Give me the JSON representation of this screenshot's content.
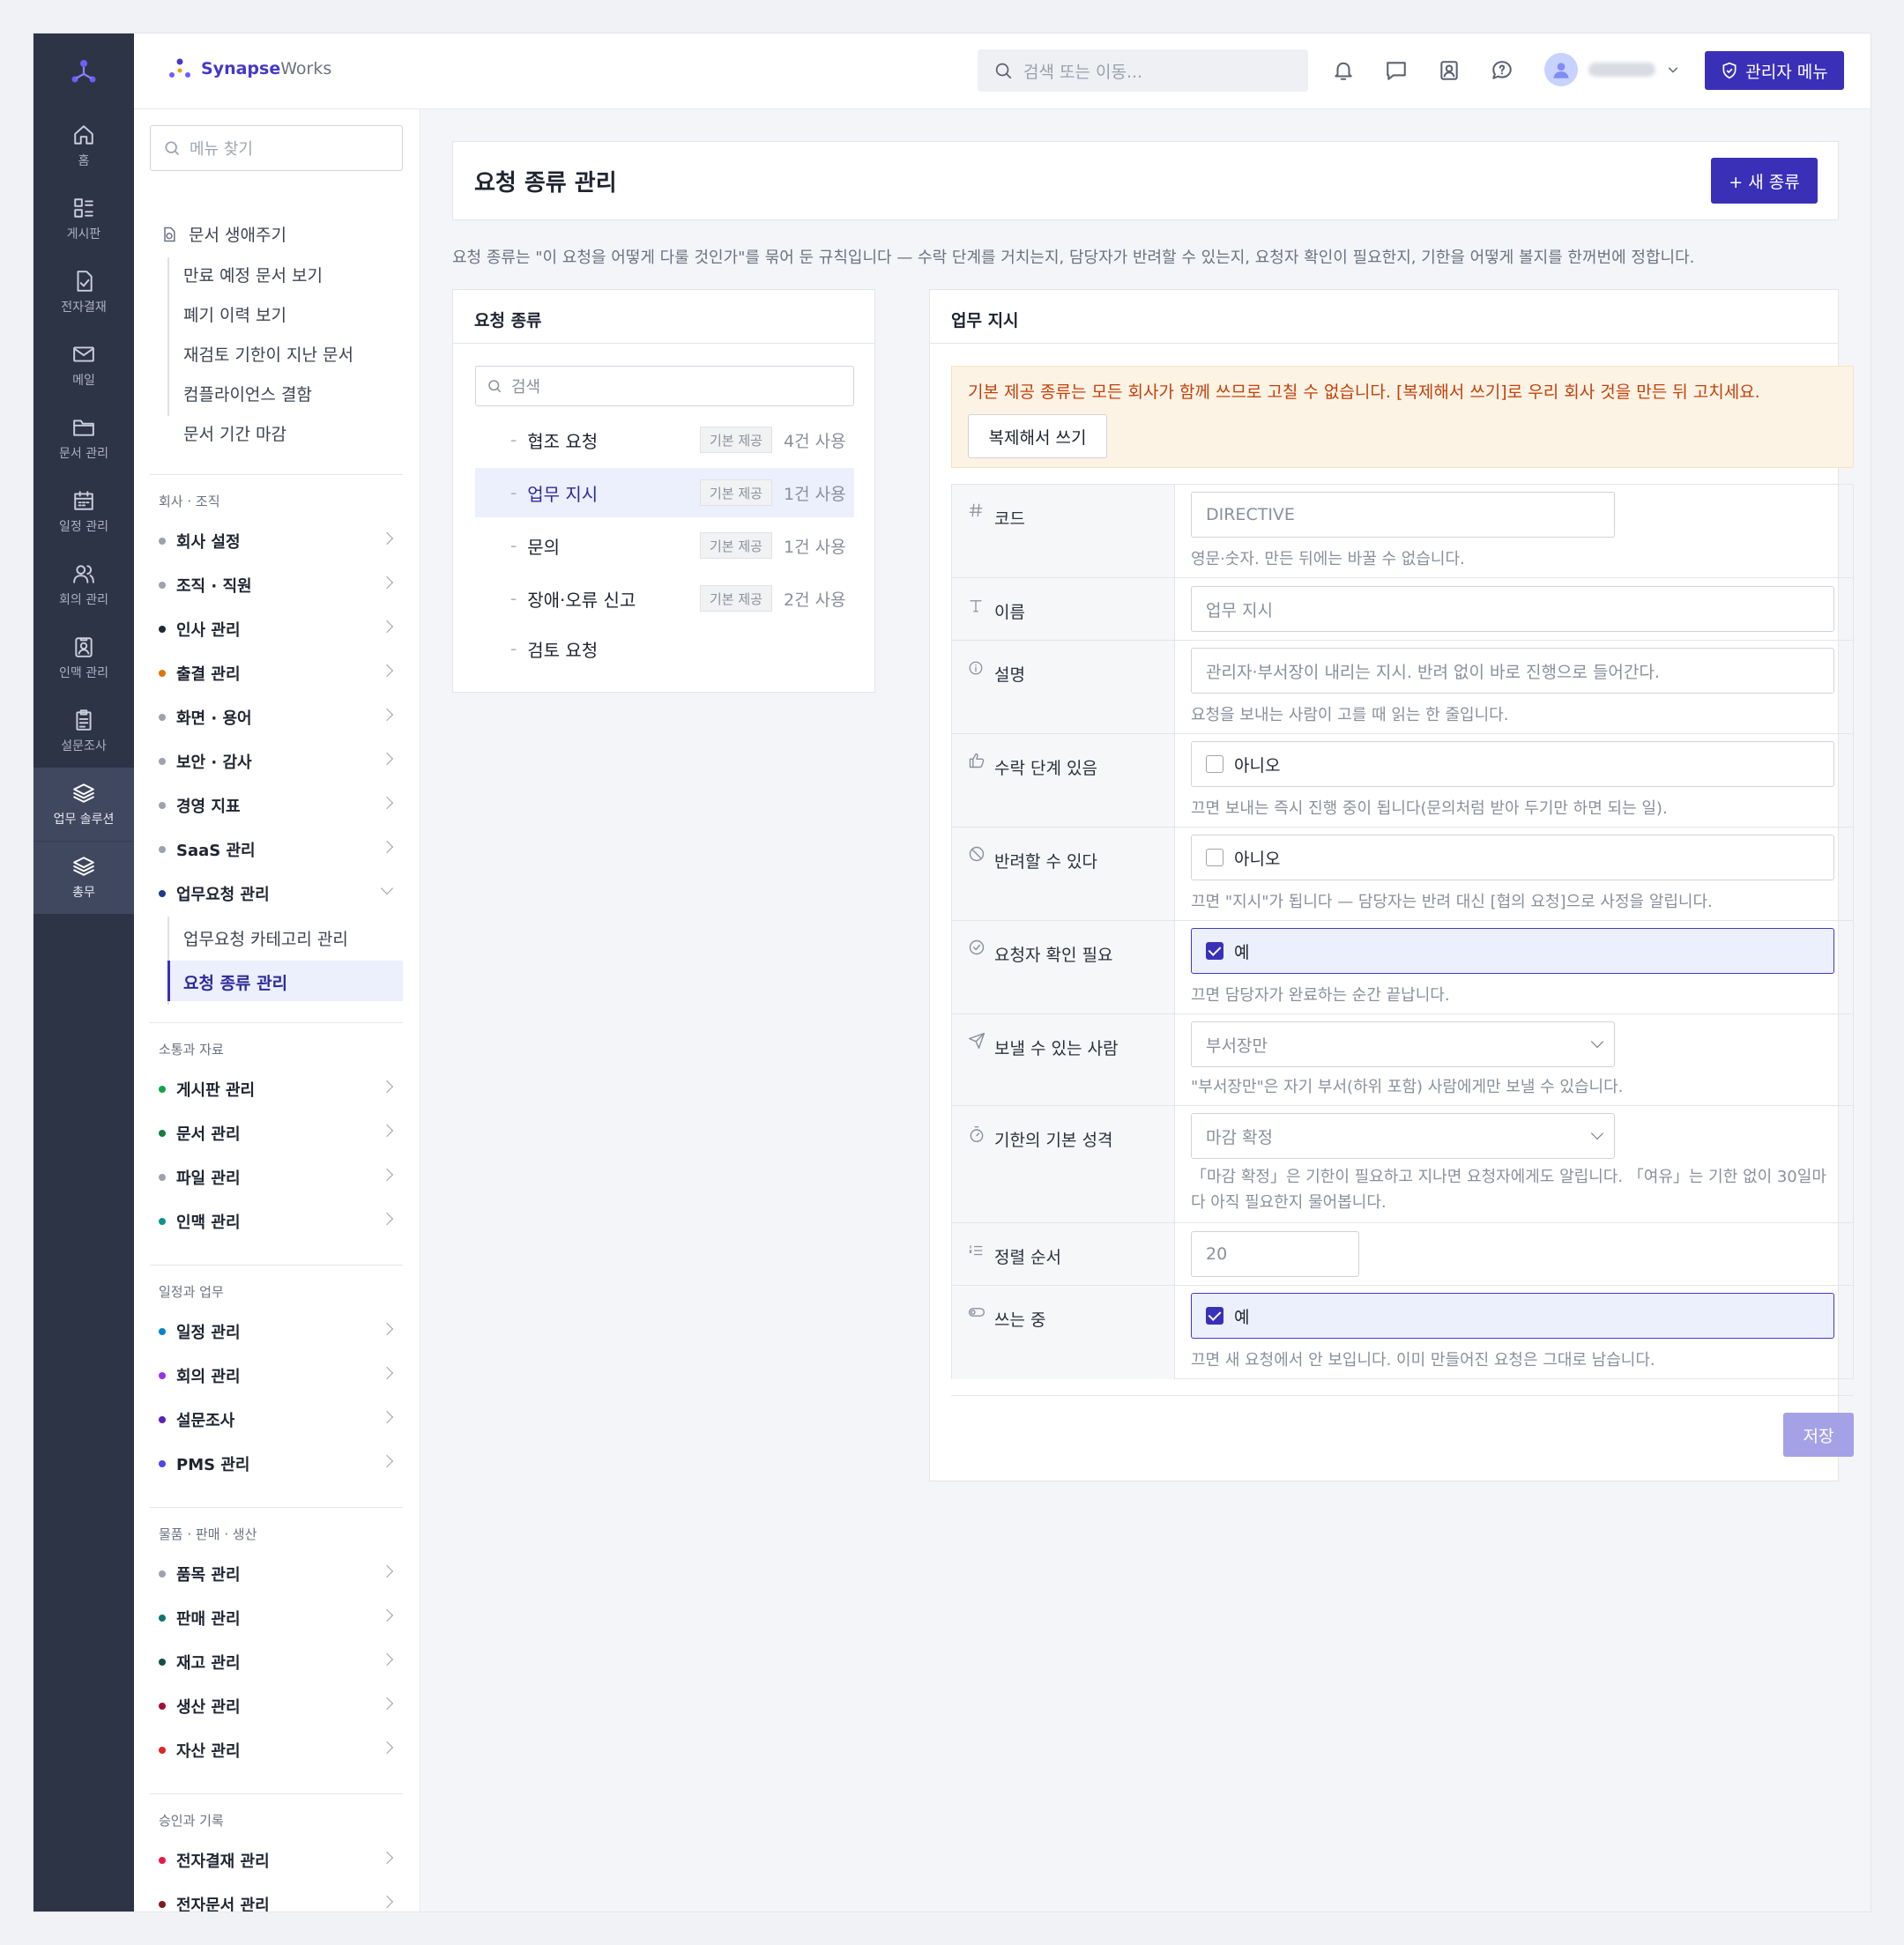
{
  "topbar": {
    "brand_primary": "Synapse",
    "brand_secondary": "Works",
    "search_placeholder": "검색 또는 이동...",
    "admin_button": "관리자 메뉴"
  },
  "rail": [
    {
      "label": "홈",
      "icon": "home-icon"
    },
    {
      "label": "게시판",
      "icon": "board-icon"
    },
    {
      "label": "전자결재",
      "icon": "approval-icon"
    },
    {
      "label": "메일",
      "icon": "mail-icon"
    },
    {
      "label": "문서 관리",
      "icon": "folder-icon"
    },
    {
      "label": "일정 관리",
      "icon": "calendar-icon"
    },
    {
      "label": "회의 관리",
      "icon": "people-icon"
    },
    {
      "label": "인맥 관리",
      "icon": "contact-icon"
    },
    {
      "label": "설문조사",
      "icon": "clipboard-icon"
    },
    {
      "label": "업무 솔루션",
      "icon": "layers-icon",
      "active": true
    },
    {
      "label": "총무",
      "icon": "layers-icon",
      "active": true
    }
  ],
  "sidenav": {
    "search_placeholder": "메뉴 찾기",
    "lifecycle": {
      "title": "문서 생애주기",
      "items": [
        "만료 예정 문서 보기",
        "폐기 이력 보기",
        "재검토 기한이 지난 문서",
        "컴플라이언스 결함",
        "문서 기간 마감"
      ]
    },
    "sections": [
      {
        "title": "회사 · 조직",
        "items": [
          {
            "label": "회사 설정",
            "color": "#9ca3af"
          },
          {
            "label": "조직 · 직원",
            "color": "#9ca3af"
          },
          {
            "label": "인사 관리",
            "color": "#1f2937"
          },
          {
            "label": "출결 관리",
            "color": "#d97706"
          },
          {
            "label": "화면 · 용어",
            "color": "#9ca3af"
          },
          {
            "label": "보안 · 감사",
            "color": "#9ca3af"
          },
          {
            "label": "경영 지표",
            "color": "#9ca3af"
          },
          {
            "label": "SaaS 관리",
            "color": "#9ca3af"
          },
          {
            "label": "업무요청 관리",
            "color": "#1e3a8a"
          }
        ]
      },
      {
        "title": "소통과 자료",
        "items": [
          {
            "label": "게시판 관리",
            "color": "#16a34a"
          },
          {
            "label": "문서 관리",
            "color": "#15803d"
          },
          {
            "label": "파일 관리",
            "color": "#9ca3af"
          },
          {
            "label": "인맥 관리",
            "color": "#0d9488"
          }
        ]
      },
      {
        "title": "일정과 업무",
        "items": [
          {
            "label": "일정 관리",
            "color": "#0284c7"
          },
          {
            "label": "회의 관리",
            "color": "#9333ea"
          },
          {
            "label": "설문조사",
            "color": "#5b21b6"
          },
          {
            "label": "PMS 관리",
            "color": "#4f46e5"
          }
        ]
      },
      {
        "title": "물품 · 판매 · 생산",
        "items": [
          {
            "label": "품목 관리",
            "color": "#9ca3af"
          },
          {
            "label": "판매 관리",
            "color": "#0f766e"
          },
          {
            "label": "재고 관리",
            "color": "#134e4a"
          },
          {
            "label": "생산 관리",
            "color": "#9f1239"
          },
          {
            "label": "자산 관리",
            "color": "#dc2626"
          }
        ]
      },
      {
        "title": "승인과 기록",
        "items": [
          {
            "label": "전자결재 관리",
            "color": "#e11d48"
          },
          {
            "label": "전자문서 관리",
            "color": "#7f1d1d"
          }
        ]
      }
    ],
    "work_request_sub": [
      "업무요청 카테고리 관리",
      "요청 종류 관리"
    ]
  },
  "page": {
    "title": "요청 종류 관리",
    "new_button": "+ 새 종류",
    "description": "요청 종류는 \"이 요청을 어떻게 다룰 것인가\"를 묶어 둔 규칙입니다 — 수락 단계를 거치는지, 담당자가 반려할 수 있는지, 요청자 확인이 필요한지, 기한을 어떻게 볼지를 한꺼번에 정합니다."
  },
  "types_panel": {
    "title": "요청 종류",
    "search_placeholder": "검색",
    "items": [
      {
        "name": "협조 요청",
        "tag": "기본 제공",
        "usage": "4건 사용"
      },
      {
        "name": "업무 지시",
        "tag": "기본 제공",
        "usage": "1건 사용",
        "active": true
      },
      {
        "name": "문의",
        "tag": "기본 제공",
        "usage": "1건 사용"
      },
      {
        "name": "장애·오류 신고",
        "tag": "기본 제공",
        "usage": "2건 사용"
      },
      {
        "name": "검토 요청",
        "tag": "",
        "usage": ""
      }
    ]
  },
  "detail": {
    "title": "업무 지시",
    "notice": "기본 제공 종류는 모든 회사가 함께 쓰므로 고칠 수 없습니다. [복제해서 쓰기]로 우리 회사 것을 만든 뒤 고치세요.",
    "clone_button": "복제해서 쓰기",
    "fields": {
      "code": {
        "label": "코드",
        "value": "DIRECTIVE",
        "help": "영문·숫자. 만든 뒤에는 바꿀 수 없습니다."
      },
      "name": {
        "label": "이름",
        "value": "업무 지시"
      },
      "desc": {
        "label": "설명",
        "value": "관리자·부서장이 내리는 지시. 반려 없이 바로 진행으로 들어간다.",
        "help": "요청을 보내는 사람이 고를 때 읽는 한 줄입니다."
      },
      "accept": {
        "label": "수락 단계 있음",
        "value": "아니오",
        "help": "끄면 보내는 즉시 진행 중이 됩니다(문의처럼 받아 두기만 하면 되는 일)."
      },
      "reject": {
        "label": "반려할 수 있다",
        "value": "아니오",
        "help": "끄면 \"지시\"가 됩니다 — 담당자는 반려 대신 [협의 요청]으로 사정을 알립니다."
      },
      "confirm": {
        "label": "요청자 확인 필요",
        "value": "예",
        "help": "끄면 담당자가 완료하는 순간 끝납니다."
      },
      "sender": {
        "label": "보낼 수 있는 사람",
        "value": "부서장만",
        "help": "\"부서장만\"은 자기 부서(하위 포함) 사람에게만 보낼 수 있습니다."
      },
      "deadline": {
        "label": "기한의 기본 성격",
        "value": "마감 확정",
        "help": "「마감 확정」은 기한이 필요하고 지나면 요청자에게도 알립니다. 「여유」는 기한 없이 30일마다 아직 필요한지 물어봅니다."
      },
      "order": {
        "label": "정렬 순서",
        "value": "20"
      },
      "active": {
        "label": "쓰는 중",
        "value": "예",
        "help": "끄면 새 요청에서 안 보입니다. 이미 만들어진 요청은 그대로 남습니다."
      }
    },
    "save_button": "저장"
  },
  "colors": {
    "accent": "#3a30b8",
    "rail": "#2d3446",
    "notice_bg": "#fdf3e4",
    "notice_text": "#c2410c",
    "save_disabled": "#a5a1e6"
  }
}
